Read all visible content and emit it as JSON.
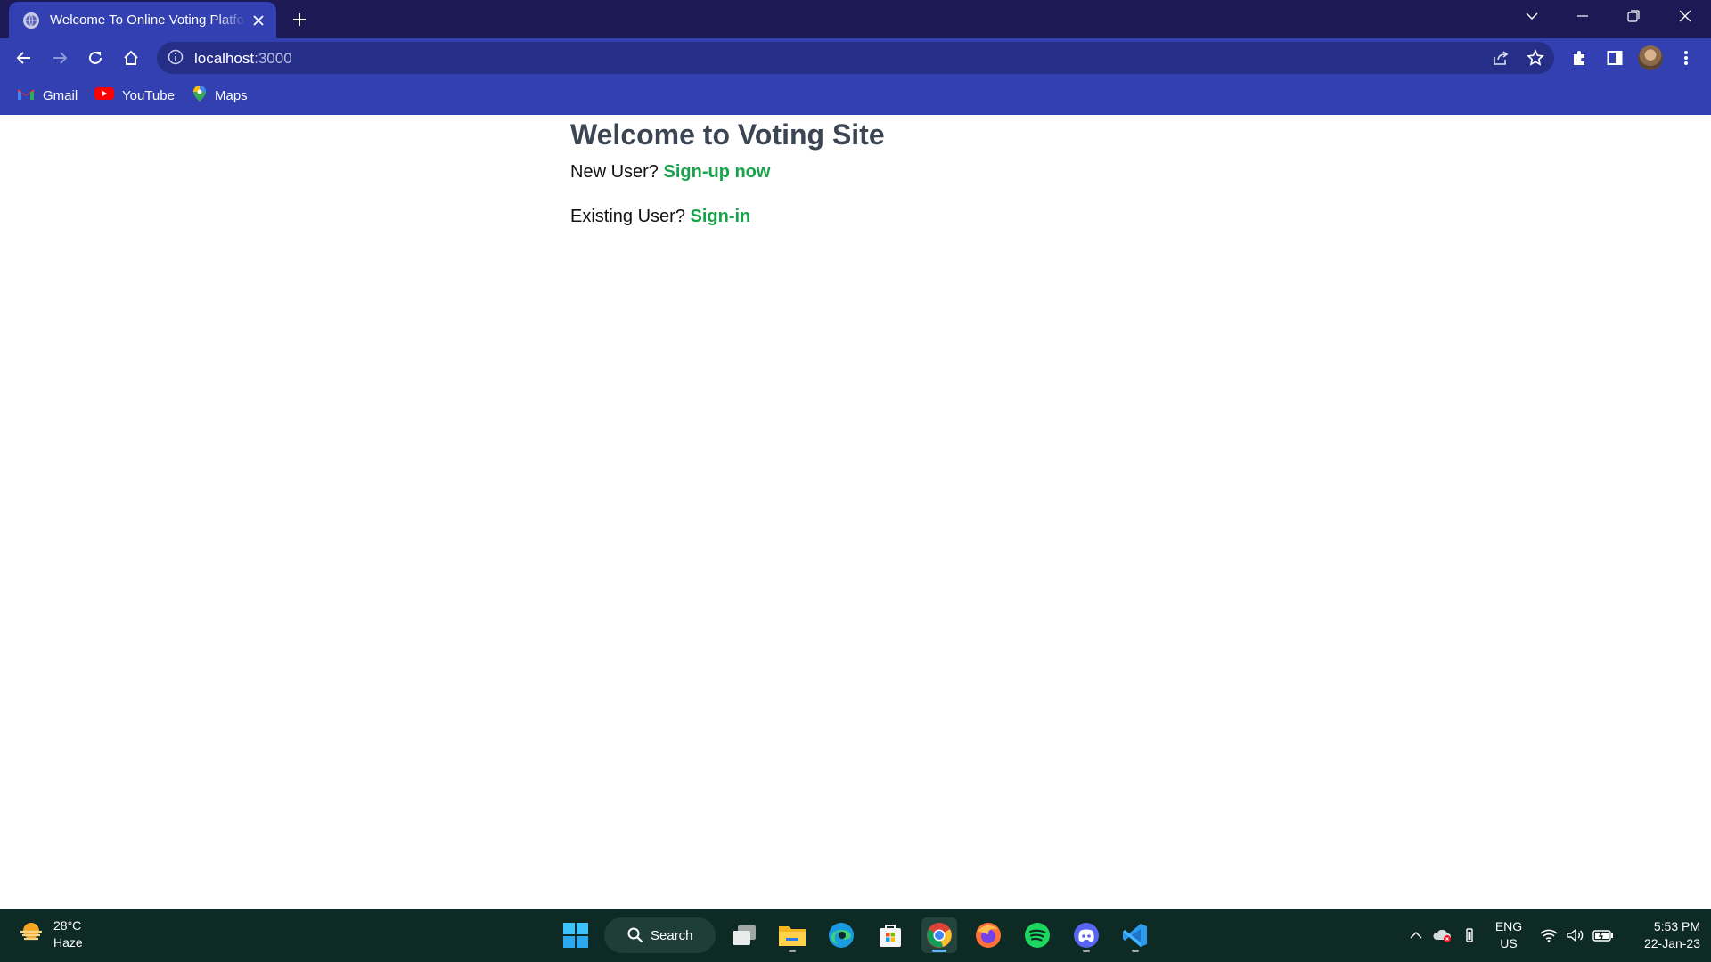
{
  "browser": {
    "tab_title": "Welcome To Online Voting Platform",
    "url_host": "localhost",
    "url_port": ":3000"
  },
  "bookmarks": [
    {
      "label": "Gmail",
      "icon": "gmail-icon"
    },
    {
      "label": "YouTube",
      "icon": "youtube-icon"
    },
    {
      "label": "Maps",
      "icon": "maps-icon"
    }
  ],
  "page": {
    "heading": "Welcome to Voting Site",
    "new_user_prompt": "New User?",
    "signup_link": "Sign-up now",
    "existing_user_prompt": "Existing User?",
    "signin_link": "Sign-in",
    "link_color": "#16a34a"
  },
  "taskbar": {
    "weather_temp": "28°C",
    "weather_condition": "Haze",
    "search_label": "Search",
    "lang_primary": "ENG",
    "lang_secondary": "US",
    "time": "5:53 PM",
    "date": "22-Jan-23"
  },
  "colors": {
    "titlebar": "#1b1a54",
    "toolbar": "#3340b1",
    "taskbar": "#0e2a24"
  }
}
